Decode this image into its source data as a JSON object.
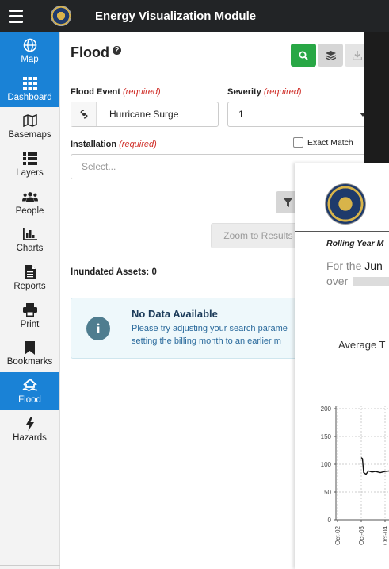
{
  "app": {
    "title": "Energy Visualization Module"
  },
  "sidebar": {
    "items": [
      {
        "label": "Map",
        "icon": "globe-icon",
        "active": true
      },
      {
        "label": "Dashboard",
        "icon": "grid-icon",
        "active": true
      },
      {
        "label": "Basemaps",
        "icon": "map-icon",
        "active": false
      },
      {
        "label": "Layers",
        "icon": "list-icon",
        "active": false
      },
      {
        "label": "People",
        "icon": "people-icon",
        "active": false
      },
      {
        "label": "Charts",
        "icon": "bar-chart-icon",
        "active": false
      },
      {
        "label": "Reports",
        "icon": "file-icon",
        "active": false
      },
      {
        "label": "Print",
        "icon": "printer-icon",
        "active": false
      },
      {
        "label": "Bookmarks",
        "icon": "bookmark-icon",
        "active": false
      },
      {
        "label": "Flood",
        "icon": "flood-house-icon",
        "active": true
      },
      {
        "label": "Hazards",
        "icon": "lightning-icon",
        "active": false
      }
    ]
  },
  "panel": {
    "title": "Flood",
    "flood_event_label": "Flood Event",
    "required_text": "(required)",
    "flood_event_value": "Hurricane Surge",
    "severity_label": "Severity",
    "severity_value": "1",
    "installation_label": "Installation",
    "installation_placeholder": "Select...",
    "exact_match_label": "Exact Match",
    "zoom_button": "Zoom to Results",
    "inundated_label": "Inundated Assets: 0",
    "alert_title": "No Data Available",
    "alert_message": "Please try adjusting your search parame\nsetting the billing month to an earlier m"
  },
  "colors": {
    "accent": "#1a82d6",
    "search_button": "#28a745",
    "topbar": "#222426"
  },
  "report": {
    "heading": "Rolling Year M",
    "line1_prefix": "For the ",
    "line1_bold": "Jun",
    "line2": "over",
    "subtitle": "Average T",
    "chart_data": {
      "type": "line",
      "y_ticks": [
        "200",
        "150",
        "100",
        "50",
        "0"
      ],
      "ylim": [
        0,
        200
      ],
      "x_ticks": [
        "Oct-02",
        "Oct-03",
        "Oct-04"
      ],
      "series": [
        {
          "values": [
            {
              "x": 1.0,
              "y": 112
            },
            {
              "x": 1.05,
              "y": 110
            },
            {
              "x": 1.1,
              "y": 85
            },
            {
              "x": 1.2,
              "y": 82
            },
            {
              "x": 1.3,
              "y": 88
            },
            {
              "x": 1.45,
              "y": 86
            },
            {
              "x": 1.6,
              "y": 87
            },
            {
              "x": 1.8,
              "y": 85
            },
            {
              "x": 2.0,
              "y": 87
            },
            {
              "x": 2.2,
              "y": 88
            }
          ]
        }
      ]
    }
  }
}
